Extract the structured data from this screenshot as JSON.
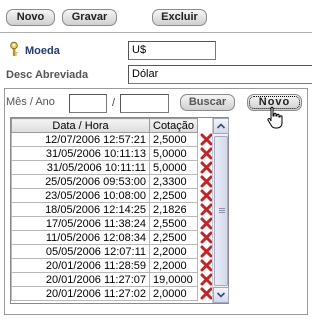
{
  "toolbar": {
    "new_label": "Novo",
    "save_label": "Gravar",
    "delete_label": "Excluir"
  },
  "form": {
    "currency_label": "Moeda",
    "currency_value": "U$",
    "short_desc_label": "Desc Abreviada",
    "short_desc_value": "Dólar"
  },
  "filter": {
    "period_label": "Mês / Ano",
    "separator": "/",
    "month_value": "",
    "year_value": "",
    "search_label": "Buscar",
    "new_label": "Novo"
  },
  "grid": {
    "columns": [
      "Data / Hora",
      "Cotação"
    ],
    "rows": [
      [
        "12/07/2006 12:57:21",
        "2,5000"
      ],
      [
        "31/05/2006 10:11:13",
        "5,0000"
      ],
      [
        "31/05/2006 10:11:11",
        "5,0000"
      ],
      [
        "25/05/2006 09:53:00",
        "2,3300"
      ],
      [
        "23/05/2006 10:08:00",
        "2,2500"
      ],
      [
        "18/05/2006 12:14:25",
        "2,1826"
      ],
      [
        "17/05/2006 11:38:24",
        "2,5500"
      ],
      [
        "11/05/2006 12:08:34",
        "2,2500"
      ],
      [
        "05/05/2006 12:07:11",
        "2,2000"
      ],
      [
        "20/01/2006 11:28:59",
        "2,2000"
      ],
      [
        "20/01/2006 11:27:07",
        "19,0000"
      ],
      [
        "20/01/2006 11:27:02",
        "2,0000"
      ]
    ]
  },
  "icons": {
    "field_key": "key-icon",
    "row_delete": "delete-x-icon",
    "pointer": "hand-cursor-icon"
  },
  "colors": {
    "delete_red": "#cc1f1f",
    "label_blue": "#1f3b7a"
  }
}
